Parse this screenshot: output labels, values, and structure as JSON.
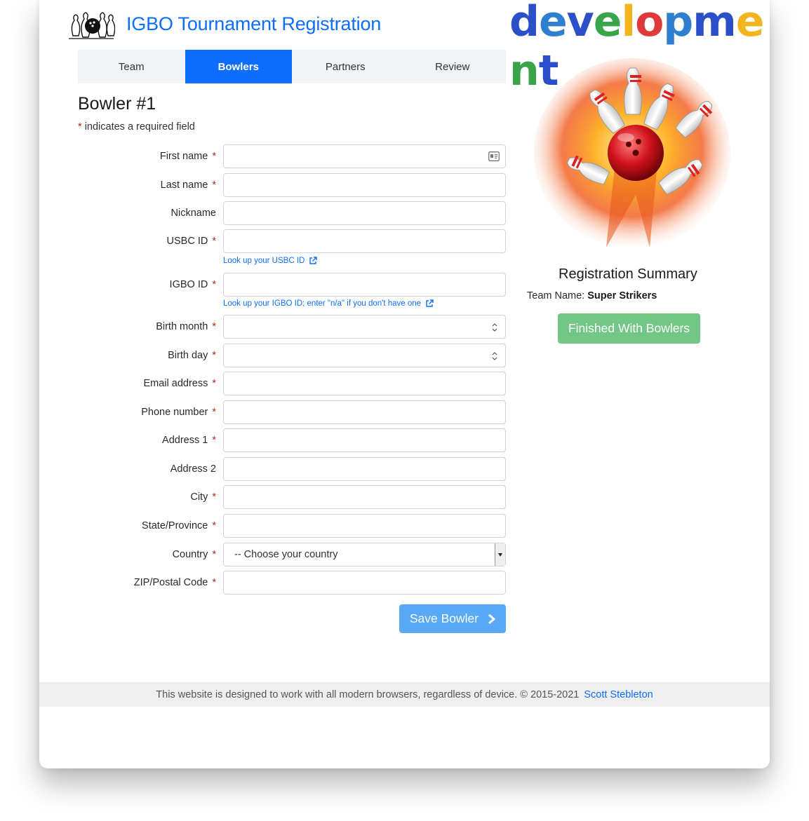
{
  "header": {
    "title": "IGBO Tournament Registration",
    "banner": "development"
  },
  "banner_letters": [
    {
      "ch": "d",
      "color": "#2b4fc8"
    },
    {
      "ch": "e",
      "color": "#2f7fd0"
    },
    {
      "ch": "v",
      "color": "#2b4fc8"
    },
    {
      "ch": "e",
      "color": "#3aa44a"
    },
    {
      "ch": "l",
      "color": "#f2b51d"
    },
    {
      "ch": "o",
      "color": "#e0393c"
    },
    {
      "ch": "p",
      "color": "#2f7fd0"
    },
    {
      "ch": "m",
      "color": "#2b4fc8"
    },
    {
      "ch": "e",
      "color": "#f2b51d"
    },
    {
      "ch": "n",
      "color": "#3aa44a"
    },
    {
      "ch": "t",
      "color": "#2b4fc8"
    }
  ],
  "tabs": [
    {
      "label": "Team",
      "active": false
    },
    {
      "label": "Bowlers",
      "active": true
    },
    {
      "label": "Partners",
      "active": false
    },
    {
      "label": "Review",
      "active": false
    }
  ],
  "form": {
    "title": "Bowler #1",
    "required_note": "indicates a required field",
    "star": "*",
    "fields": [
      {
        "label": "First name",
        "required": true,
        "kind": "text",
        "value": ""
      },
      {
        "label": "Last name",
        "required": true,
        "kind": "text",
        "value": ""
      },
      {
        "label": "Nickname",
        "required": false,
        "kind": "text",
        "value": ""
      },
      {
        "label": "USBC ID",
        "required": true,
        "kind": "text",
        "value": ""
      },
      {
        "label": "IGBO ID",
        "required": true,
        "kind": "text",
        "value": ""
      },
      {
        "label": "Birth month",
        "required": true,
        "kind": "number",
        "value": ""
      },
      {
        "label": "Birth day",
        "required": true,
        "kind": "number",
        "value": ""
      },
      {
        "label": "Email address",
        "required": true,
        "kind": "text",
        "value": ""
      },
      {
        "label": "Phone number",
        "required": true,
        "kind": "text",
        "value": ""
      },
      {
        "label": "Address 1",
        "required": true,
        "kind": "text",
        "value": ""
      },
      {
        "label": "Address 2",
        "required": false,
        "kind": "text",
        "value": ""
      },
      {
        "label": "City",
        "required": true,
        "kind": "text",
        "value": ""
      },
      {
        "label": "State/Province",
        "required": true,
        "kind": "text",
        "value": ""
      },
      {
        "label": "Country",
        "required": true,
        "kind": "select",
        "value": "-- Choose your country"
      },
      {
        "label": "ZIP/Postal Code",
        "required": true,
        "kind": "text",
        "value": ""
      }
    ],
    "usbc_help": "Look up your USBC ID",
    "igbo_help": "Look up your IGBO ID; enter \"n/a\" if you don't have one",
    "save_label": "Save Bowler"
  },
  "summary": {
    "title": "Registration Summary",
    "team_label": "Team Name:",
    "team_name": "Super Strikers",
    "finish_label": "Finished With Bowlers"
  },
  "footer": {
    "text": "This website is designed to work with all modern browsers, regardless of device. © 2015-2021",
    "author": "Scott Stebleton"
  },
  "colors": {
    "primary": "#0d6efd",
    "save": "#59a9f6",
    "finish": "#72c686",
    "required": "#b0271f"
  },
  "icons": [
    "bowling-logo-icon",
    "contact-card-icon",
    "external-link-icon",
    "spinner-arrows-icon",
    "chevron-right-icon",
    "bowling-strike-image"
  ]
}
